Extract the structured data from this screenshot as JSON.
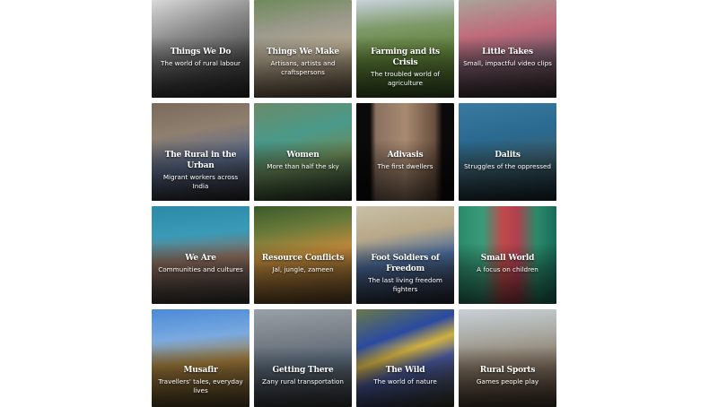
{
  "tiles": [
    {
      "title": "Things We Do",
      "subtitle": "The world of rural labour",
      "bg": "linear-gradient(160deg,#d9d9d9 0%,#8a8a8a 35%,#4a4a4a 70%,#2a2a2a 100%)"
    },
    {
      "title": "Things We Make",
      "subtitle": "Artisans, artists and craftspersons",
      "bg": "linear-gradient(170deg,#6f8a5a 0%,#9b9a8c 30%,#b8aa92 55%,#6d5a44 100%)"
    },
    {
      "title": "Farming and its Crisis",
      "subtitle": "The troubled world of agriculture",
      "bg": "linear-gradient(175deg,#c8d2dc 0%,#7f9a6a 28%,#5f7f3a 55%,#3e5a24 100%)"
    },
    {
      "title": "Little Takes",
      "subtitle": "Small, impactful video clips",
      "bg": "linear-gradient(170deg,#a9a49a 0%,#c06a7a 35%,#7a5a6a 60%,#3a2e2e 100%)"
    },
    {
      "title": "The Rural in the Urban",
      "subtitle": "Migrant workers across India",
      "bg": "linear-gradient(170deg,#7a6a5a 0%,#8f7f6f 30%,#5a6a8a 60%,#2e2a2a 100%)"
    },
    {
      "title": "Women",
      "subtitle": "More than half the sky",
      "bg": "linear-gradient(165deg,#6a8a6a 0%,#4a9a8a 35%,#6a8a5a 60%,#2a3a2a 100%)"
    },
    {
      "title": "Adivasis",
      "subtitle": "The first dwellers",
      "bg": "linear-gradient(90deg,#0a0a0a 0%,#0a0a0a 14%,#8a7060 20%,#a88a70 50%,#6a5040 80%,#0a0a0a 88%,#0a0a0a 100%)"
    },
    {
      "title": "Dalits",
      "subtitle": "Struggles of the oppressed",
      "bg": "linear-gradient(170deg,#3a7aa0 0%,#2a6a90 35%,#3a6070 60%,#1a2a30 100%)"
    },
    {
      "title": "We Are",
      "subtitle": "Communities and cultures",
      "bg": "linear-gradient(175deg,#2a8aa8 0%,#3a9ab8 30%,#8a6a5a 55%,#3a3a3a 100%)"
    },
    {
      "title": "Resource Conflicts",
      "subtitle": "Jal, jungle, zameen",
      "bg": "linear-gradient(170deg,#3a5a2a 0%,#6a7a3a 25%,#c08a3a 50%,#6a4a2a 100%)"
    },
    {
      "title": "Foot Soldiers of Freedom",
      "subtitle": "The last living freedom fighters",
      "bg": "linear-gradient(170deg,#c8c0a8 0%,#b8a888 30%,#4a6a9a 55%,#2a2a30 100%)"
    },
    {
      "title": "Small World",
      "subtitle": "A focus on children",
      "bg": "linear-gradient(90deg,#2a8a6a 0%,#3a9a7a 25%,#c04a4a 45%,#b04050 60%,#2a8a6a 80%,#1a6a5a 100%)"
    },
    {
      "title": "Musafir",
      "subtitle": "Travellers' tales, everyday lives",
      "bg": "linear-gradient(175deg,#4a8ad8 0%,#7aaae0 30%,#a07a3a 55%,#5a4a2a 100%)"
    },
    {
      "title": "Getting There",
      "subtitle": "Zany rural transportation",
      "bg": "linear-gradient(175deg,#9aa0a8 0%,#7a8088 30%,#5a6a7a 55%,#3a3a3a 100%)"
    },
    {
      "title": "The Wild",
      "subtitle": "The world of nature",
      "bg": "linear-gradient(160deg,#6a7a4a 0%,#2a4aa0 30%,#d0b040 45%,#4a5aa0 60%,#3a3a2a 100%)"
    },
    {
      "title": "Rural Sports",
      "subtitle": "Games people play",
      "bg": "linear-gradient(175deg,#c8d0d8 0%,#a8a8a0 30%,#8a7a6a 55%,#4a3a2a 100%)"
    }
  ]
}
